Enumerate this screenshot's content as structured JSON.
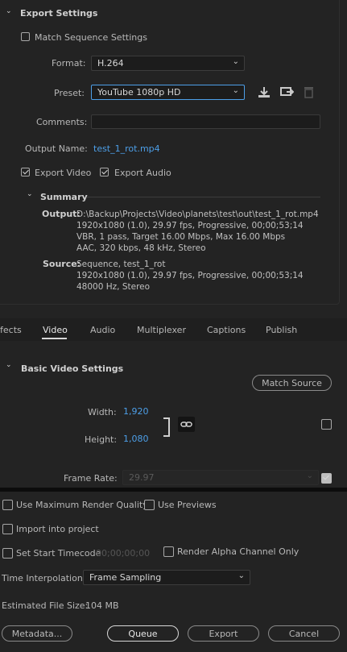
{
  "export_settings": {
    "title": "Export Settings",
    "match_sequence_label": "Match Sequence Settings",
    "format_label": "Format:",
    "format_value": "H.264",
    "preset_label": "Preset:",
    "preset_value": "YouTube 1080p HD",
    "comments_label": "Comments:",
    "comments_value": "",
    "output_name_label": "Output Name:",
    "output_name_value": "test_1_rot.mp4",
    "export_video_label": "Export Video",
    "export_video_checked": true,
    "export_audio_label": "Export Audio",
    "export_audio_checked": true
  },
  "summary": {
    "title": "Summary",
    "output_label": "Output:",
    "output_lines": [
      "D:\\Backup\\Projects\\Video\\planets\\test\\out\\test_1_rot.mp4",
      "1920x1080 (1.0), 29.97 fps, Progressive, 00;00;53;14",
      "VBR, 1 pass, Target 16.00 Mbps, Max 16.00 Mbps",
      "AAC, 320 kbps, 48 kHz, Stereo"
    ],
    "source_label": "Source:",
    "source_lines": [
      "Sequence, test_1_rot",
      "1920x1080 (1.0), 29.97 fps, Progressive, 00;00;53;14",
      "48000 Hz, Stereo"
    ]
  },
  "tabs": [
    "fects",
    "Video",
    "Audio",
    "Multiplexer",
    "Captions",
    "Publish"
  ],
  "active_tab": "Video",
  "video": {
    "section_title": "Basic Video Settings",
    "match_source_label": "Match Source",
    "width_label": "Width:",
    "width_value": "1,920",
    "height_label": "Height:",
    "height_value": "1,080",
    "frame_rate_label": "Frame Rate:",
    "frame_rate_value": "29.97"
  },
  "bottom": {
    "max_render_label": "Use Maximum Render Quality",
    "use_previews_label": "Use Previews",
    "import_label": "Import into project",
    "start_timecode_label": "Set Start Timecode",
    "start_timecode_value": "00;00;00;00",
    "alpha_label": "Render Alpha Channel Only",
    "time_interp_label": "Time Interpolation:",
    "time_interp_value": "Frame Sampling",
    "file_size_label": "Estimated File Size:",
    "file_size_value": "104 MB"
  },
  "buttons": {
    "metadata": "Metadata...",
    "queue": "Queue",
    "export": "Export",
    "cancel": "Cancel"
  }
}
